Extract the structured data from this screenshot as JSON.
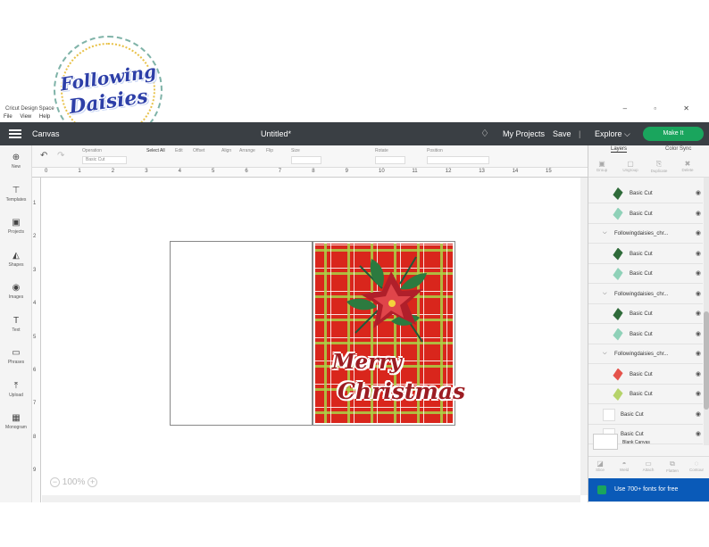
{
  "logo": {
    "line1": "Following",
    "line2": "Daisies"
  },
  "window": {
    "title": "Cricut Design Space",
    "controls": "–  ▫  ✕"
  },
  "menu": [
    "File",
    "View",
    "Help"
  ],
  "header": {
    "canvas_label": "Canvas",
    "doc_title": "Untitled*",
    "my_projects": "My Projects",
    "save": "Save",
    "separator": "|",
    "explore": "Explore ⌵",
    "make_it": "Make It"
  },
  "sidebar": [
    {
      "icon": "plus-icon",
      "glyph": "⊕",
      "label": "New"
    },
    {
      "icon": "shirt-icon",
      "glyph": "⊤",
      "label": "Templates"
    },
    {
      "icon": "folder-icon",
      "glyph": "▣",
      "label": "Projects"
    },
    {
      "icon": "shapes-icon",
      "glyph": "◭",
      "label": "Shapes"
    },
    {
      "icon": "bulb-icon",
      "glyph": "◉",
      "label": "Images"
    },
    {
      "icon": "text-icon",
      "glyph": "T",
      "label": "Text"
    },
    {
      "icon": "chat-icon",
      "glyph": "▭",
      "label": "Phrases"
    },
    {
      "icon": "upload-icon",
      "glyph": "⤒",
      "label": "Upload"
    },
    {
      "icon": "monogram-icon",
      "glyph": "▦",
      "label": "Monogram"
    }
  ],
  "toolbar": {
    "operation": "Operation",
    "operation_value": "Basic Cut",
    "select_all": "Select All",
    "edit": "Edit",
    "offset": "Offset",
    "align": "Align",
    "arrange": "Arrange",
    "flip": "Flip",
    "size": "Size",
    "rotate": "Rotate",
    "position": "Position"
  },
  "ruler": {
    "top": [
      "0",
      "1",
      "2",
      "3",
      "4",
      "5",
      "6",
      "7",
      "8",
      "9",
      "10",
      "11",
      "12",
      "13",
      "14",
      "15"
    ],
    "left": [
      "1",
      "2",
      "3",
      "4",
      "5",
      "6",
      "7",
      "8",
      "9"
    ]
  },
  "canvas": {
    "merry": "Merry",
    "christmas": "Christmas",
    "zoom": "100%"
  },
  "layers_panel": {
    "tab_layers": "Layers",
    "tab_color_sync": "Color Sync",
    "actions": [
      "Group",
      "Ungroup",
      "Duplicate",
      "Delete"
    ],
    "items": [
      {
        "type": "item",
        "label": "Basic Cut",
        "thumb": "#2f6b3a"
      },
      {
        "type": "item",
        "label": "Basic Cut",
        "thumb": "#8fd1b8"
      },
      {
        "type": "group",
        "label": "Followingdaisies_chr..."
      },
      {
        "type": "item",
        "label": "Basic Cut",
        "thumb": "#2f6b3a"
      },
      {
        "type": "item",
        "label": "Basic Cut",
        "thumb": "#8fd1b8"
      },
      {
        "type": "group",
        "label": "Followingdaisies_chr..."
      },
      {
        "type": "item",
        "label": "Basic Cut",
        "thumb": "#2f6b3a"
      },
      {
        "type": "item",
        "label": "Basic Cut",
        "thumb": "#8fd1b8"
      },
      {
        "type": "group",
        "label": "Followingdaisies_chr..."
      },
      {
        "type": "item",
        "label": "Basic Cut",
        "thumb": "#e5534b"
      },
      {
        "type": "item",
        "label": "Basic Cut",
        "thumb": "#b5d36a"
      },
      {
        "type": "plain",
        "label": "Basic Cut"
      },
      {
        "type": "plain",
        "label": "Basic Cut"
      }
    ],
    "blank_canvas": "Blank Canvas",
    "bottom_actions": [
      "Slice",
      "Weld",
      "Attach",
      "Flatten",
      "Contour"
    ],
    "promo": "Use 700+ fonts for free"
  },
  "colors": {
    "header_bg": "#3a3f44",
    "make_it": "#1aa55d",
    "promo_bg": "#0a5ab8",
    "card_red": "#d9261c",
    "text_red": "#9c1c22"
  }
}
